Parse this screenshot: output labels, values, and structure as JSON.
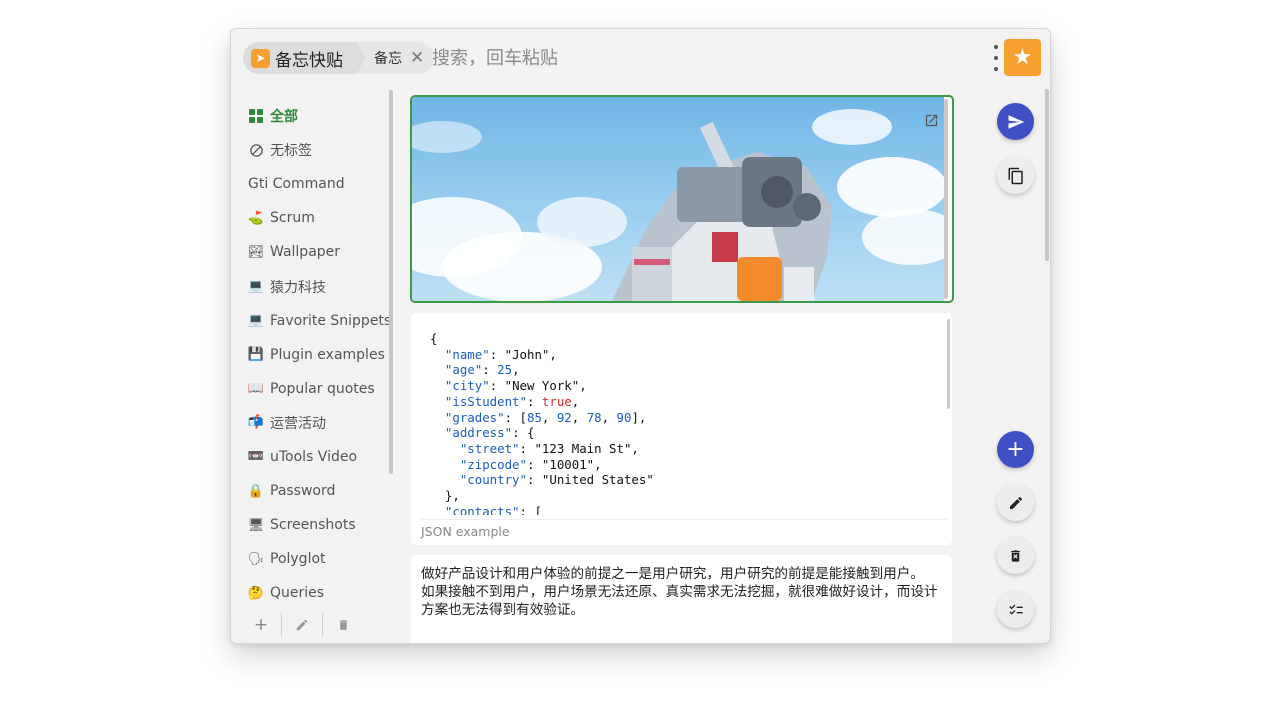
{
  "header": {
    "app_name": "备忘快贴",
    "sub_tab": "备忘",
    "search_placeholder": "搜索，回车粘贴"
  },
  "sidebar": {
    "items": [
      {
        "label": "全部",
        "icon": "grid-icon",
        "active": true
      },
      {
        "label": "无标签",
        "icon": "no-tag-icon"
      },
      {
        "label": "Gti Command",
        "icon": ""
      },
      {
        "label": "Scrum",
        "icon": "golf-icon",
        "glyph": "⛳"
      },
      {
        "label": "Wallpaper",
        "icon": "landscape-icon",
        "glyph": "🏞"
      },
      {
        "label": "猿力科技",
        "icon": "computer-icon",
        "glyph": "💻"
      },
      {
        "label": "Favorite Snippets",
        "icon": "computer-icon",
        "glyph": "💻"
      },
      {
        "label": "Plugin examples",
        "icon": "floppy-icon",
        "glyph": "💾"
      },
      {
        "label": "Popular quotes",
        "icon": "book-icon",
        "glyph": "📖"
      },
      {
        "label": "运营活动",
        "icon": "mailbox-icon",
        "glyph": "📬"
      },
      {
        "label": "uTools Video",
        "icon": "video-icon",
        "glyph": "📼"
      },
      {
        "label": "Password",
        "icon": "lock-icon",
        "glyph": "🔒"
      },
      {
        "label": "Screenshots",
        "icon": "monitor-icon",
        "glyph": "🖥"
      },
      {
        "label": "Polyglot",
        "icon": "speaking-icon",
        "glyph": "🗣"
      },
      {
        "label": "Queries",
        "icon": "thinking-icon",
        "glyph": "🤔"
      }
    ]
  },
  "cards": {
    "json": {
      "lines": [
        "{",
        "  \"name\": \"John\",",
        "  \"age\": 25,",
        "  \"city\": \"New York\",",
        "  \"isStudent\": true,",
        "  \"grades\": [85, 92, 78, 90],",
        "  \"address\": {",
        "    \"street\": \"123 Main St\",",
        "    \"zipcode\": \"10001\",",
        "    \"country\": \"United States\"",
        "  },",
        "  \"contacts\": ["
      ],
      "caption": "JSON example"
    },
    "text": {
      "paragraph1": "做好产品设计和用户体验的前提之一是用户研究，用户研究的前提是能接触到用户。",
      "paragraph2": "如果接触不到用户，用户场景无法还原、真实需求无法挖掘，就很难做好设计，而设计方案也无法得到有效验证。"
    }
  },
  "colors": {
    "accent_green": "#3d9a48",
    "fab_blue": "#3f4fc4",
    "logo_orange": "#f7a030"
  }
}
